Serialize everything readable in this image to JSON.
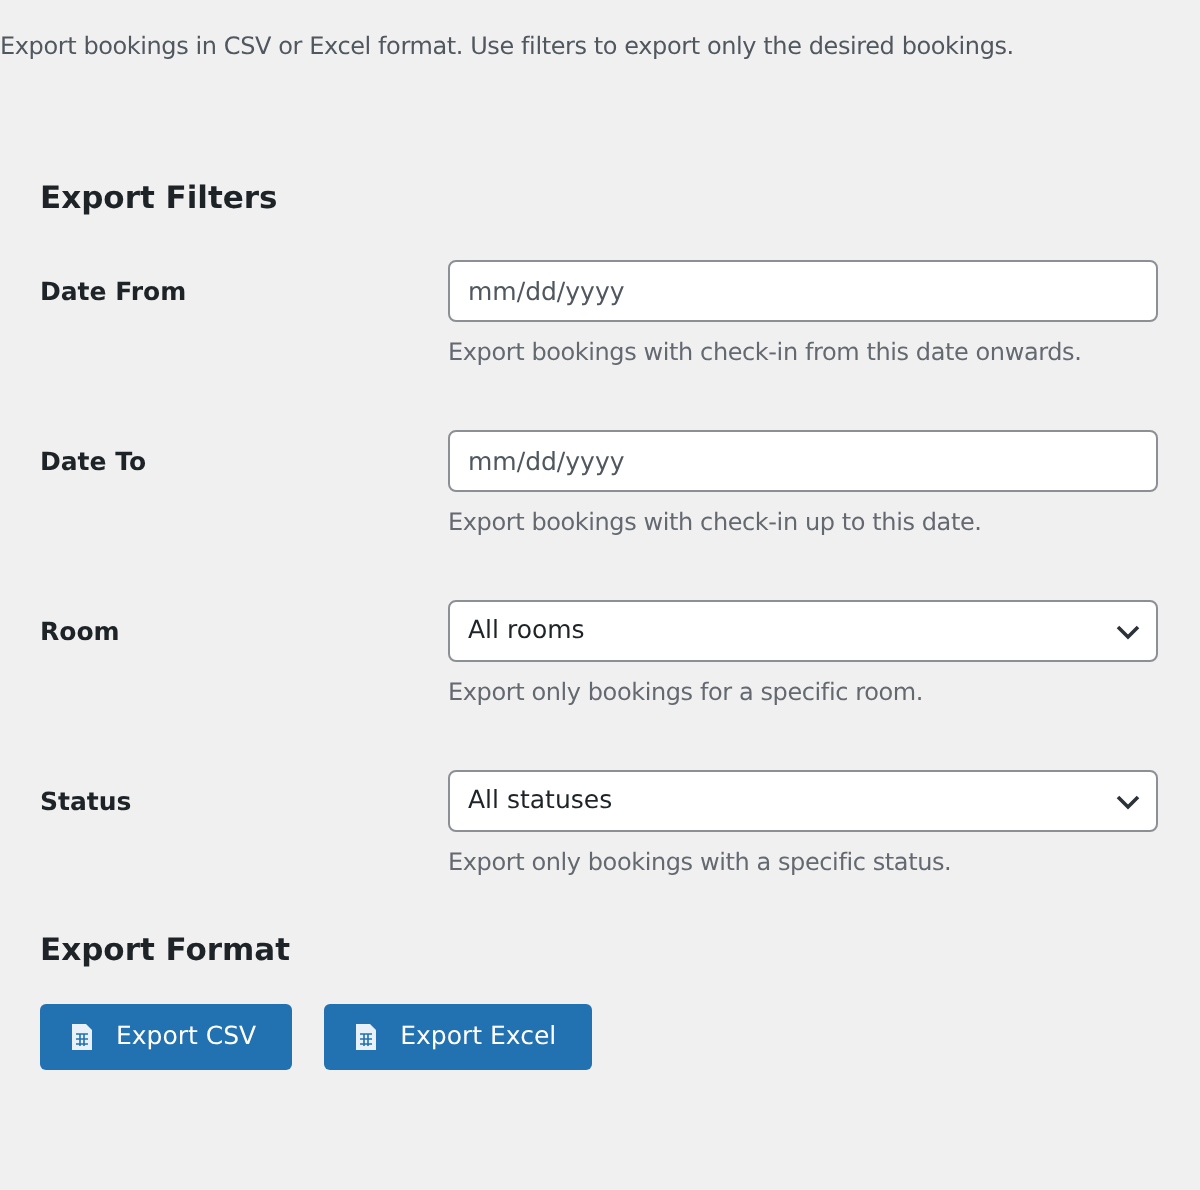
{
  "intro": "Export bookings in CSV or Excel format. Use filters to export only the desired bookings.",
  "filters": {
    "heading": "Export Filters",
    "rows": [
      {
        "label": "Date From",
        "kind": "date",
        "placeholder": "mm/dd/yyyy",
        "description": "Export bookings with check-in from this date onwards."
      },
      {
        "label": "Date To",
        "kind": "date",
        "placeholder": "mm/dd/yyyy",
        "description": "Export bookings with check-in up to this date."
      },
      {
        "label": "Room",
        "kind": "select",
        "value": "All rooms",
        "description": "Export only bookings for a specific room."
      },
      {
        "label": "Status",
        "kind": "select",
        "value": "All statuses",
        "description": "Export only bookings with a specific status."
      }
    ]
  },
  "format": {
    "heading": "Export Format",
    "buttons": [
      "Export CSV",
      "Export Excel"
    ]
  }
}
